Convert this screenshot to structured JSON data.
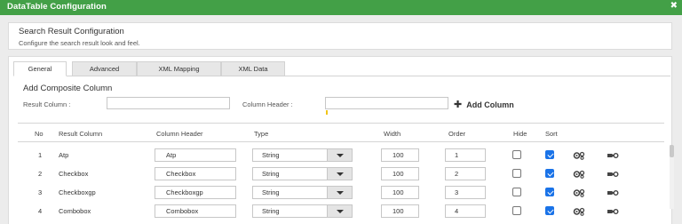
{
  "window": {
    "title": "DataTable Configuration",
    "close_icon": "close-icon"
  },
  "search_panel": {
    "heading": "Search Result Configuration",
    "subheading": "Configure the search result look and feel."
  },
  "tabs": [
    {
      "label": "General",
      "active": true
    },
    {
      "label": "Advanced",
      "active": false
    },
    {
      "label": "XML Mapping",
      "active": false
    },
    {
      "label": "XML Data",
      "active": false
    }
  ],
  "composite": {
    "heading": "Add Composite Column",
    "result_label": "Result Column :",
    "header_label": "Column Header :",
    "result_value": "",
    "header_value": "",
    "add_label": "Add Column",
    "add_icon": "plus-icon"
  },
  "table": {
    "headers": {
      "no": "No",
      "result": "Result Column",
      "header": "Column Header",
      "type": "Type",
      "width": "Width",
      "order": "Order",
      "hide": "Hide",
      "sort": "Sort"
    },
    "rows": [
      {
        "no": "1",
        "result": "Atp",
        "header": "Atp",
        "type": "String",
        "width": "100",
        "order": "1",
        "hide": false,
        "sort": true
      },
      {
        "no": "2",
        "result": "Checkbox",
        "header": "Checkbox",
        "type": "String",
        "width": "100",
        "order": "2",
        "hide": false,
        "sort": true
      },
      {
        "no": "3",
        "result": "Checkboxgp",
        "header": "Checkboxgp",
        "type": "String",
        "width": "100",
        "order": "3",
        "hide": false,
        "sort": true
      },
      {
        "no": "4",
        "result": "Combobox",
        "header": "Combobox",
        "type": "String",
        "width": "100",
        "order": "4",
        "hide": false,
        "sort": true
      }
    ],
    "row_icons": [
      "gears-icon",
      "tag-gear-icon"
    ]
  },
  "colors": {
    "titlebar": "#43a047",
    "checkbox_on": "#1a73e8",
    "caret": "#f0c419"
  }
}
